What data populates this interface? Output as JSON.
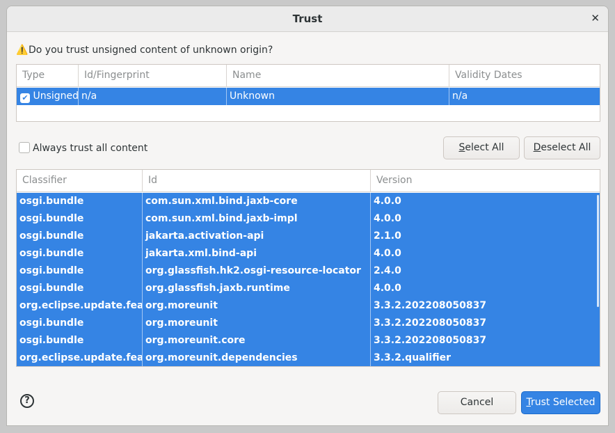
{
  "window": {
    "title": "Trust",
    "close_glyph": "✕"
  },
  "prompt": {
    "icon": "warning-icon",
    "icon_glyph": "⚠️",
    "text": "Do you trust unsigned content of unknown origin?"
  },
  "trust_table": {
    "columns": [
      "Type",
      "Id/Fingerprint",
      "Name",
      "Validity Dates"
    ],
    "rows": [
      {
        "checked": true,
        "type": "Unsigned",
        "id": "n/a",
        "name": "Unknown",
        "validity": "n/a"
      }
    ]
  },
  "always_trust": {
    "label": "Always trust all content",
    "checked": false
  },
  "buttons": {
    "select_all": {
      "mnemonic": "S",
      "rest": "elect All"
    },
    "deselect_all": {
      "mnemonic": "D",
      "rest": "eselect All"
    },
    "cancel": "Cancel",
    "trust_selected": {
      "mnemonic": "T",
      "rest": "rust Selected"
    }
  },
  "content_table": {
    "columns": [
      "Classifier",
      "Id",
      "Version"
    ],
    "rows": [
      {
        "classifier": "osgi.bundle",
        "id": "com.sun.xml.bind.jaxb-core",
        "version": "4.0.0"
      },
      {
        "classifier": "osgi.bundle",
        "id": "com.sun.xml.bind.jaxb-impl",
        "version": "4.0.0"
      },
      {
        "classifier": "osgi.bundle",
        "id": "jakarta.activation-api",
        "version": "2.1.0"
      },
      {
        "classifier": "osgi.bundle",
        "id": "jakarta.xml.bind-api",
        "version": "4.0.0"
      },
      {
        "classifier": "osgi.bundle",
        "id": "org.glassfish.hk2.osgi-resource-locator",
        "version": "2.4.0"
      },
      {
        "classifier": "osgi.bundle",
        "id": "org.glassfish.jaxb.runtime",
        "version": "4.0.0"
      },
      {
        "classifier": "org.eclipse.update.feature",
        "id": "org.moreunit",
        "version": "3.3.2.202208050837"
      },
      {
        "classifier": "osgi.bundle",
        "id": "org.moreunit",
        "version": "3.3.2.202208050837"
      },
      {
        "classifier": "osgi.bundle",
        "id": "org.moreunit.core",
        "version": "3.3.2.202208050837"
      },
      {
        "classifier": "org.eclipse.update.feature",
        "id": "org.moreunit.dependencies",
        "version": "3.3.2.qualifier"
      }
    ]
  },
  "help": {
    "icon": "help-icon",
    "glyph": "?"
  }
}
